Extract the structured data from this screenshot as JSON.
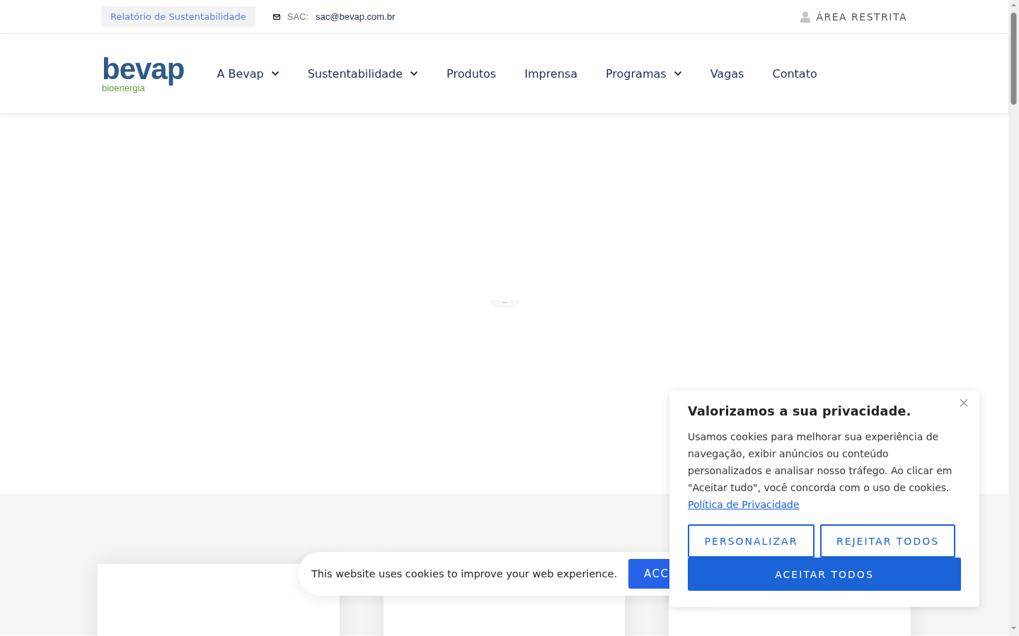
{
  "top_bar": {
    "report_link": "Relatório de Sustentabilidade",
    "sac_label": "SAC:",
    "sac_email": "sac@bevap.com.br",
    "restricted_area": "ÁREA RESTRITA"
  },
  "logo": {
    "name": "bevap",
    "tagline": "bioenergia"
  },
  "nav": [
    {
      "label": "A Bevap",
      "has_dropdown": true
    },
    {
      "label": "Sustentabilidade",
      "has_dropdown": true
    },
    {
      "label": "Produtos",
      "has_dropdown": false
    },
    {
      "label": "Imprensa",
      "has_dropdown": false
    },
    {
      "label": "Programas",
      "has_dropdown": true
    },
    {
      "label": "Vagas",
      "has_dropdown": false
    },
    {
      "label": "Contato",
      "has_dropdown": false
    }
  ],
  "cards": [
    {
      "kind": "card"
    },
    {
      "kind": "card"
    },
    {
      "kind": "card"
    }
  ],
  "cookie_banner": {
    "text": "This website uses cookies to improve your web experience.",
    "button": "ACC"
  },
  "consent_dialog": {
    "title": "Valorizamos a sua privacidade.",
    "body": "Usamos cookies para melhorar sua experiência de navegação, exibir anúncios ou conteúdo personalizados e analisar nosso tráfego. Ao clicar em \"Aceitar tudo\", você concorda com o uso de cookies.",
    "policy_link": "Política de Privacidade",
    "buttons": [
      {
        "label": "PERSONALIZAR",
        "kind": "outline"
      },
      {
        "label": "REJEITAR TODOS",
        "kind": "outline"
      },
      {
        "label": "ACEITAR TODOS",
        "kind": "primary"
      }
    ]
  }
}
